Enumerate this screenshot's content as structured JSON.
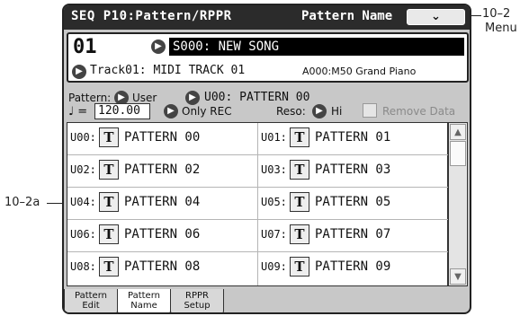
{
  "titlebar": {
    "title": "SEQ P10:Pattern/RPPR",
    "page_name": "Pattern Name",
    "menu_icon": "chevron-down-icon"
  },
  "song": {
    "number": "01",
    "name": "S000: NEW SONG"
  },
  "track": {
    "label": "Track01: MIDI TRACK 01",
    "program": "A000:M50 Grand Piano"
  },
  "pattern": {
    "label": "Pattern:",
    "bank": "User",
    "current": "U00: PATTERN 00"
  },
  "tempo": {
    "symbol": "♩ =",
    "value": "120.00",
    "mode": "Only REC",
    "reso_label": "Reso:",
    "reso_value": "Hi",
    "remove_label": "Remove Data"
  },
  "patterns": [
    {
      "id": "U00:",
      "t": "T",
      "name": "PATTERN 00"
    },
    {
      "id": "U01:",
      "t": "T",
      "name": "PATTERN 01"
    },
    {
      "id": "U02:",
      "t": "T",
      "name": "PATTERN 02"
    },
    {
      "id": "U03:",
      "t": "T",
      "name": "PATTERN 03"
    },
    {
      "id": "U04:",
      "t": "T",
      "name": "PATTERN 04"
    },
    {
      "id": "U05:",
      "t": "T",
      "name": "PATTERN 05"
    },
    {
      "id": "U06:",
      "t": "T",
      "name": "PATTERN 06"
    },
    {
      "id": "U07:",
      "t": "T",
      "name": "PATTERN 07"
    },
    {
      "id": "U08:",
      "t": "T",
      "name": "PATTERN 08"
    },
    {
      "id": "U09:",
      "t": "T",
      "name": "PATTERN 09"
    }
  ],
  "tabs": [
    {
      "line1": "Pattern",
      "line2": "Edit"
    },
    {
      "line1": "Pattern",
      "line2": "Name"
    },
    {
      "line1": "RPPR",
      "line2": "Setup"
    }
  ],
  "annotations": {
    "menu_ref": "10–2",
    "menu_label": "Menu",
    "list_ref": "10–2a"
  }
}
